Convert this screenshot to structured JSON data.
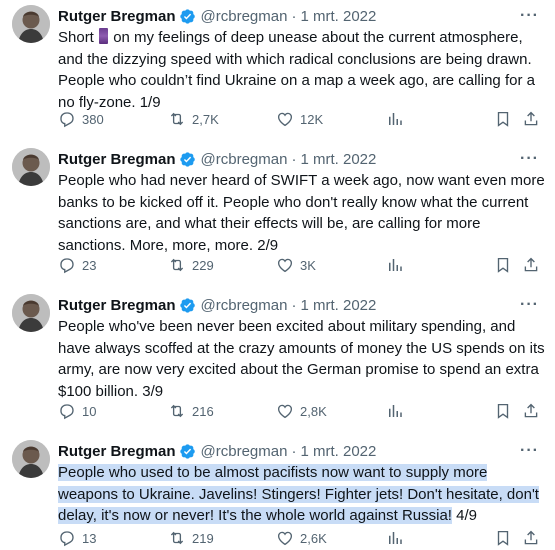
{
  "author": {
    "name": "Rutger Bregman",
    "handle": "@rcbregman",
    "separator": "·",
    "date": "1 mrt. 2022"
  },
  "more_label": "···",
  "colors": {
    "verified": "#1d9bf0",
    "muted": "#536471",
    "highlight": "#c8dcf6",
    "text": "#0f1419"
  },
  "tweets": [
    {
      "text_pre": "Short ",
      "emoji": "purple-flag",
      "text": " on my feelings of deep unease about the current atmosphere, and the dizzying speed with which radical conclusions are being drawn. People who couldn’t find Ukraine on a map a week ago, are calling for a no fly-zone. 1/9",
      "replies": "380",
      "retweets": "2,7K",
      "likes": "12K"
    },
    {
      "text": "People who had never heard of SWIFT a week ago, now want even more banks to be kicked off it. People who don't really know what the current sanctions are, and what their effects will be, are calling for more sanctions. More, more, more. 2/9",
      "replies": "23",
      "retweets": "229",
      "likes": "3K"
    },
    {
      "text": "People who've been never been excited about military spending, and have always scoffed at the crazy amounts of money the US spends on its army, are now very excited about the German promise to spend an extra $100 billion. 3/9",
      "replies": "10",
      "retweets": "216",
      "likes": "2,8K"
    },
    {
      "text_highlighted": "People who used to be almost pacifists now want to  supply more weapons to Ukraine. Javelins! Stingers! Fighter jets! Don't hesitate, don't delay, it's now or never! It's the whole world against Russia!",
      "text_after": " 4/9",
      "replies": "13",
      "retweets": "219",
      "likes": "2,6K"
    }
  ]
}
